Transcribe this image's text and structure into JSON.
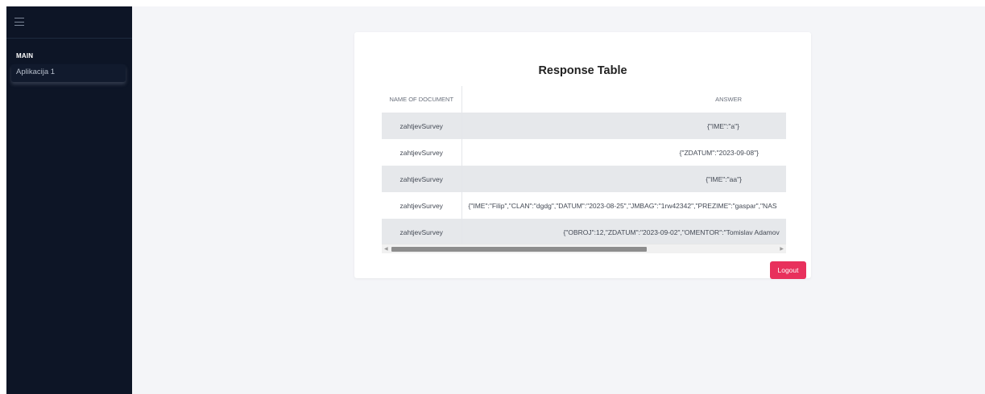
{
  "sidebar": {
    "menu_icon": "hamburger-menu-icon",
    "section_label": "MAIN",
    "items": [
      {
        "label": "Aplikacija 1"
      }
    ]
  },
  "card": {
    "title": "Response Table",
    "table": {
      "columns": [
        "NAME OF DOCUMENT",
        "ANSWER"
      ],
      "rows": [
        {
          "name": "zahtjevSurvey",
          "answer": "{\"IME\":\"a\"}"
        },
        {
          "name": "zahtjevSurvey",
          "answer": "{\"ZDATUM\":\"2023-09-08\"}"
        },
        {
          "name": "zahtjevSurvey",
          "answer": "{\"IME\":\"aa\"}"
        },
        {
          "name": "zahtjevSurvey",
          "answer": "{\"IME\":\"Filip\",\"CLAN\":\"dgdg\",\"DATUM\":\"2023-08-25\",\"JMBAG\":\"1rw42342\",\"PREZIME\":\"gaspar\",\"NAS"
        },
        {
          "name": "zahtjevSurvey",
          "answer": "{\"OBROJ\":12,\"ZDATUM\":\"2023-09-02\",\"OMENTOR\":\"Tomislav Adamov"
        }
      ]
    },
    "logout_label": "Logout"
  },
  "colors": {
    "sidebar_bg": "#0d1526",
    "logout_bg": "#e8305c",
    "row_stripe": "#e6e8eb"
  }
}
